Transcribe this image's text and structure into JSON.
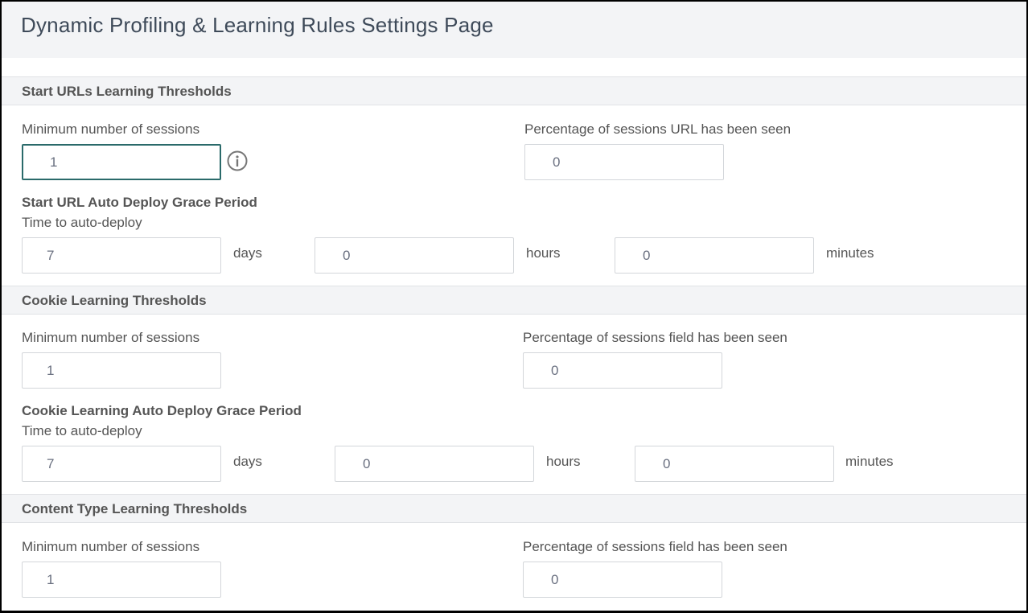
{
  "page": {
    "title": "Dynamic Profiling & Learning Rules Settings Page"
  },
  "sections": {
    "start_urls": {
      "title": "Start URLs Learning Thresholds",
      "min_sessions_label": "Minimum number of sessions",
      "min_sessions_value": "1",
      "percentage_label": "Percentage of sessions URL has been seen",
      "percentage_value": "0",
      "grace_title": "Start URL Auto Deploy Grace Period",
      "time_label": "Time to auto-deploy",
      "days_value": "7",
      "days_unit": "days",
      "hours_value": "0",
      "hours_unit": "hours",
      "minutes_value": "0",
      "minutes_unit": "minutes"
    },
    "cookie": {
      "title": "Cookie Learning Thresholds",
      "min_sessions_label": "Minimum number of sessions",
      "min_sessions_value": "1",
      "percentage_label": "Percentage of sessions field has been seen",
      "percentage_value": "0",
      "grace_title": "Cookie Learning Auto Deploy Grace Period",
      "time_label": "Time to auto-deploy",
      "days_value": "7",
      "days_unit": "days",
      "hours_value": "0",
      "hours_unit": "hours",
      "minutes_value": "0",
      "minutes_unit": "minutes"
    },
    "content_type": {
      "title": "Content Type Learning Thresholds",
      "min_sessions_label": "Minimum number of sessions",
      "min_sessions_value": "1",
      "percentage_label": "Percentage of sessions field has been seen",
      "percentage_value": "0"
    }
  },
  "icons": {
    "info": "info-circle-icon"
  },
  "colors": {
    "header_bg": "#f3f4f6",
    "focus_border": "#2a6a6a",
    "title_text": "#3e4a59"
  }
}
